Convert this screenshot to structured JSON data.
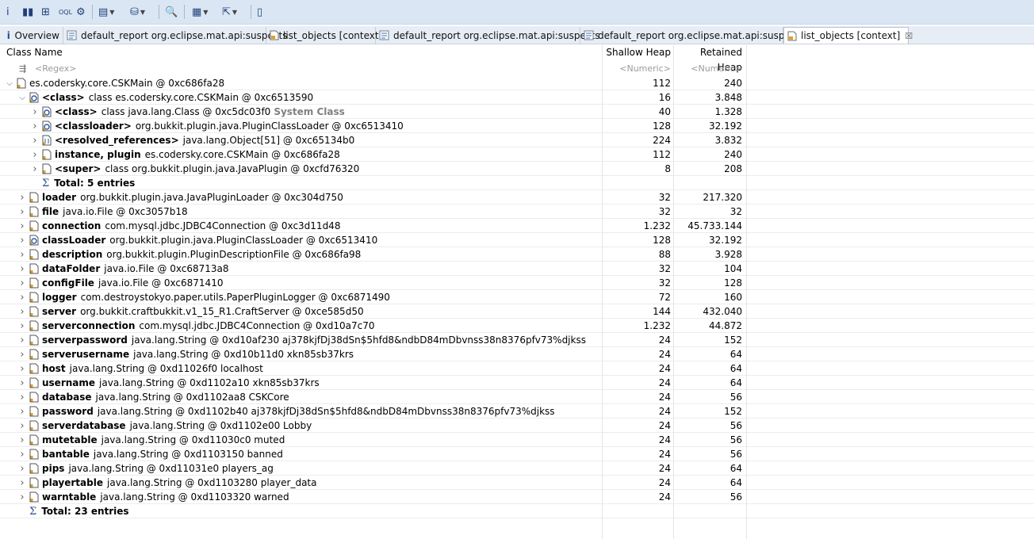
{
  "toolbar": {
    "buttons": [
      {
        "name": "info-button",
        "glyph": "i"
      },
      {
        "name": "histogram-button",
        "glyph": "▮▮"
      },
      {
        "name": "dominator-tree-button",
        "glyph": "⊞"
      },
      {
        "name": "oql-button",
        "glyph": "OQL"
      },
      {
        "name": "heap-dump-overview-button",
        "glyph": "⚙"
      },
      {
        "name": "run-report-button",
        "glyph": "▤"
      },
      {
        "name": "query-browser-button",
        "glyph": "⛁"
      },
      {
        "name": "find-object-button",
        "glyph": "🔍"
      },
      {
        "name": "group-by-button",
        "glyph": "▦"
      },
      {
        "name": "export-button",
        "glyph": "⇱"
      },
      {
        "name": "calculate-retained-button",
        "glyph": "▯"
      }
    ]
  },
  "tabs": [
    {
      "label": "Overview",
      "icon": "info-icon"
    },
    {
      "label": "default_report  org.eclipse.mat.api:suspects",
      "icon": "report-icon"
    },
    {
      "label": "list_objects  [context]",
      "icon": "list-icon"
    },
    {
      "label": "default_report  org.eclipse.mat.api:suspects",
      "icon": "report-icon"
    },
    {
      "label": "default_report  org.eclipse.mat.api:suspects",
      "icon": "report-icon"
    },
    {
      "label": "list_objects  [context]",
      "icon": "list-icon",
      "active": true,
      "close": "☒"
    }
  ],
  "table": {
    "columns": {
      "name": "Class Name",
      "shallow": "Shallow Heap",
      "retained": "Retained Heap"
    },
    "filters": {
      "name": "<Regex>",
      "shallow": "<Numeric>",
      "retained": "<Numeric>"
    },
    "rows": [
      {
        "level": 0,
        "twisty": "open",
        "icon": "object",
        "field": "",
        "text": "es.codersky.core.CSKMain @ 0xc686fa28",
        "shallow": "112",
        "retained": "240"
      },
      {
        "level": 1,
        "twisty": "open",
        "icon": "class",
        "field": "<class>",
        "text": "class es.codersky.core.CSKMain @ 0xc6513590",
        "shallow": "16",
        "retained": "3.848"
      },
      {
        "level": 2,
        "twisty": "closed",
        "icon": "class",
        "field": "<class>",
        "text": "class java.lang.Class @ 0xc5dc03f0",
        "sys": "System Class",
        "shallow": "40",
        "retained": "1.328"
      },
      {
        "level": 2,
        "twisty": "closed",
        "icon": "class",
        "field": "<classloader>",
        "text": "org.bukkit.plugin.java.PluginClassLoader @ 0xc6513410",
        "shallow": "128",
        "retained": "32.192"
      },
      {
        "level": 2,
        "twisty": "closed",
        "icon": "array",
        "field": "<resolved_references>",
        "text": "java.lang.Object[51] @ 0xc65134b0",
        "shallow": "224",
        "retained": "3.832"
      },
      {
        "level": 2,
        "twisty": "closed",
        "icon": "object",
        "field": "instance, plugin",
        "text": "es.codersky.core.CSKMain @ 0xc686fa28",
        "shallow": "112",
        "retained": "240"
      },
      {
        "level": 2,
        "twisty": "closed",
        "icon": "object",
        "field": "<super>",
        "text": "class org.bukkit.plugin.java.JavaPlugin @ 0xcfd76320",
        "shallow": "8",
        "retained": "208"
      },
      {
        "level": 2,
        "twisty": "none",
        "icon": "sigma",
        "field": "",
        "text": "Total: 5 entries",
        "total": true,
        "shallow": "",
        "retained": ""
      },
      {
        "level": 1,
        "twisty": "closed",
        "icon": "object",
        "field": "loader",
        "text": "org.bukkit.plugin.java.JavaPluginLoader @ 0xc304d750",
        "shallow": "32",
        "retained": "217.320"
      },
      {
        "level": 1,
        "twisty": "closed",
        "icon": "object",
        "field": "file",
        "text": "java.io.File @ 0xc3057b18",
        "shallow": "32",
        "retained": "32"
      },
      {
        "level": 1,
        "twisty": "closed",
        "icon": "object",
        "field": "connection",
        "text": "com.mysql.jdbc.JDBC4Connection @ 0xc3d11d48",
        "shallow": "1.232",
        "retained": "45.733.144"
      },
      {
        "level": 1,
        "twisty": "closed",
        "icon": "class",
        "field": "classLoader",
        "text": "org.bukkit.plugin.java.PluginClassLoader @ 0xc6513410",
        "shallow": "128",
        "retained": "32.192"
      },
      {
        "level": 1,
        "twisty": "closed",
        "icon": "object",
        "field": "description",
        "text": "org.bukkit.plugin.PluginDescriptionFile @ 0xc686fa98",
        "shallow": "88",
        "retained": "3.928"
      },
      {
        "level": 1,
        "twisty": "closed",
        "icon": "object",
        "field": "dataFolder",
        "text": "java.io.File @ 0xc68713a8",
        "shallow": "32",
        "retained": "104"
      },
      {
        "level": 1,
        "twisty": "closed",
        "icon": "object",
        "field": "configFile",
        "text": "java.io.File @ 0xc6871410",
        "shallow": "32",
        "retained": "128"
      },
      {
        "level": 1,
        "twisty": "closed",
        "icon": "object",
        "field": "logger",
        "text": "com.destroystokyo.paper.utils.PaperPluginLogger @ 0xc6871490",
        "shallow": "72",
        "retained": "160"
      },
      {
        "level": 1,
        "twisty": "closed",
        "icon": "object",
        "field": "server",
        "text": "org.bukkit.craftbukkit.v1_15_R1.CraftServer @ 0xce585d50",
        "shallow": "144",
        "retained": "432.040"
      },
      {
        "level": 1,
        "twisty": "closed",
        "icon": "object",
        "field": "serverconnection",
        "text": "com.mysql.jdbc.JDBC4Connection @ 0xd10a7c70",
        "shallow": "1.232",
        "retained": "44.872"
      },
      {
        "level": 1,
        "twisty": "closed",
        "icon": "object",
        "field": "serverpassword",
        "text": "java.lang.String @ 0xd10af230  aj378kjfDj38dSn$5hfd8&ndbD84mDbvnss38n8376pfv73%djkss",
        "shallow": "24",
        "retained": "152"
      },
      {
        "level": 1,
        "twisty": "closed",
        "icon": "object",
        "field": "serverusername",
        "text": "java.lang.String @ 0xd10b11d0  xkn85sb37krs",
        "shallow": "24",
        "retained": "64"
      },
      {
        "level": 1,
        "twisty": "closed",
        "icon": "object",
        "field": "host",
        "text": "java.lang.String @ 0xd11026f0  localhost",
        "shallow": "24",
        "retained": "64"
      },
      {
        "level": 1,
        "twisty": "closed",
        "icon": "object",
        "field": "username",
        "text": "java.lang.String @ 0xd1102a10  xkn85sb37krs",
        "shallow": "24",
        "retained": "64"
      },
      {
        "level": 1,
        "twisty": "closed",
        "icon": "object",
        "field": "database",
        "text": "java.lang.String @ 0xd1102aa8  CSKCore",
        "shallow": "24",
        "retained": "56"
      },
      {
        "level": 1,
        "twisty": "closed",
        "icon": "object",
        "field": "password",
        "text": "java.lang.String @ 0xd1102b40  aj378kjfDj38dSn$5hfd8&ndbD84mDbvnss38n8376pfv73%djkss",
        "shallow": "24",
        "retained": "152"
      },
      {
        "level": 1,
        "twisty": "closed",
        "icon": "object",
        "field": "serverdatabase",
        "text": "java.lang.String @ 0xd1102e00  Lobby",
        "shallow": "24",
        "retained": "56"
      },
      {
        "level": 1,
        "twisty": "closed",
        "icon": "object",
        "field": "mutetable",
        "text": "java.lang.String @ 0xd11030c0  muted",
        "shallow": "24",
        "retained": "56"
      },
      {
        "level": 1,
        "twisty": "closed",
        "icon": "object",
        "field": "bantable",
        "text": "java.lang.String @ 0xd1103150  banned",
        "shallow": "24",
        "retained": "56"
      },
      {
        "level": 1,
        "twisty": "closed",
        "icon": "object",
        "field": "pips",
        "text": "java.lang.String @ 0xd11031e0  players_ag",
        "shallow": "24",
        "retained": "64"
      },
      {
        "level": 1,
        "twisty": "closed",
        "icon": "object",
        "field": "playertable",
        "text": "java.lang.String @ 0xd1103280  player_data",
        "shallow": "24",
        "retained": "64"
      },
      {
        "level": 1,
        "twisty": "closed",
        "icon": "object",
        "field": "warntable",
        "text": "java.lang.String @ 0xd1103320  warned",
        "shallow": "24",
        "retained": "56"
      },
      {
        "level": 1,
        "twisty": "none",
        "icon": "sigma",
        "field": "",
        "text": "Total: 23 entries",
        "total": true,
        "shallow": "",
        "retained": ""
      }
    ]
  }
}
